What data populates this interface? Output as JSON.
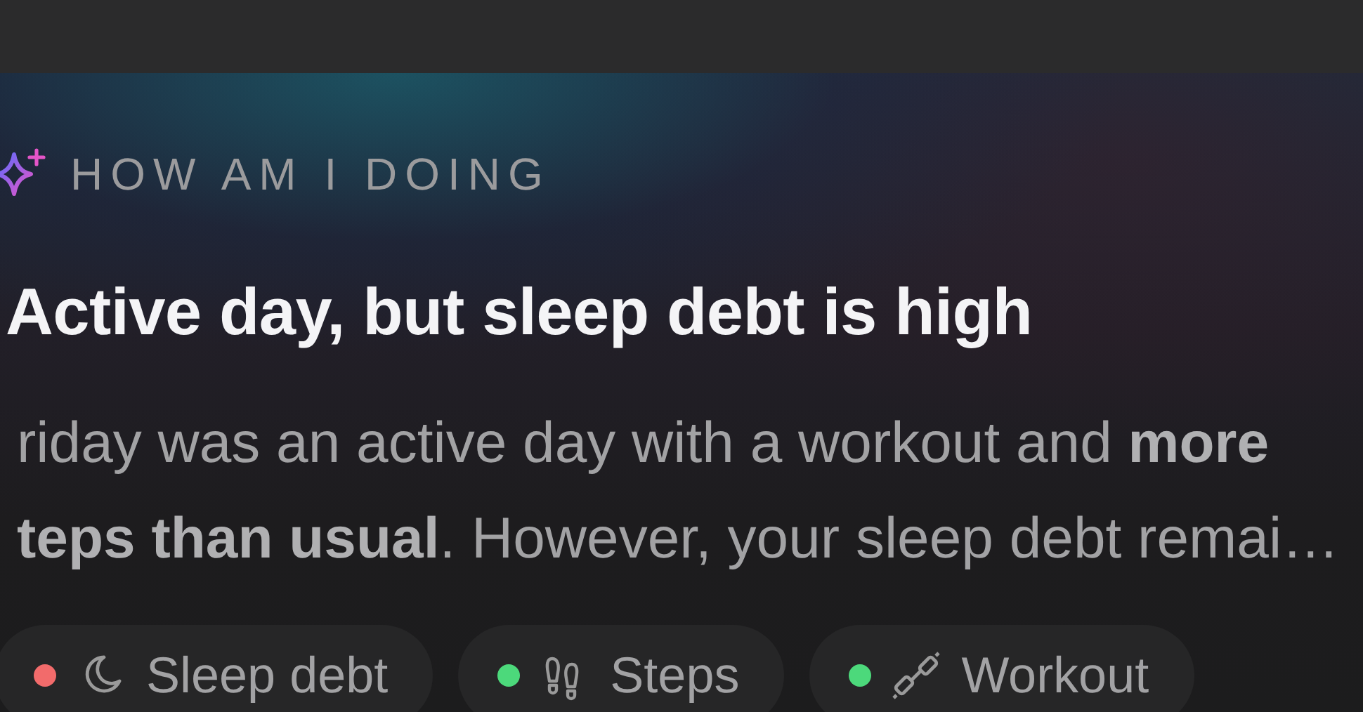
{
  "card": {
    "eyebrow": "HOW AM I DOING",
    "title": "Active day, but sleep debt is high",
    "summary": [
      "riday was an active day with a workout and **more**",
      "**teps than usual**. However, your sleep debt remai…"
    ],
    "chips": [
      {
        "label": "Sleep debt",
        "color": "#f26b6b",
        "kind": "sleep"
      },
      {
        "label": "Steps",
        "color": "#4cd97b",
        "kind": "steps"
      },
      {
        "label": "Workout",
        "color": "#4cd97b",
        "kind": "workout"
      }
    ]
  }
}
